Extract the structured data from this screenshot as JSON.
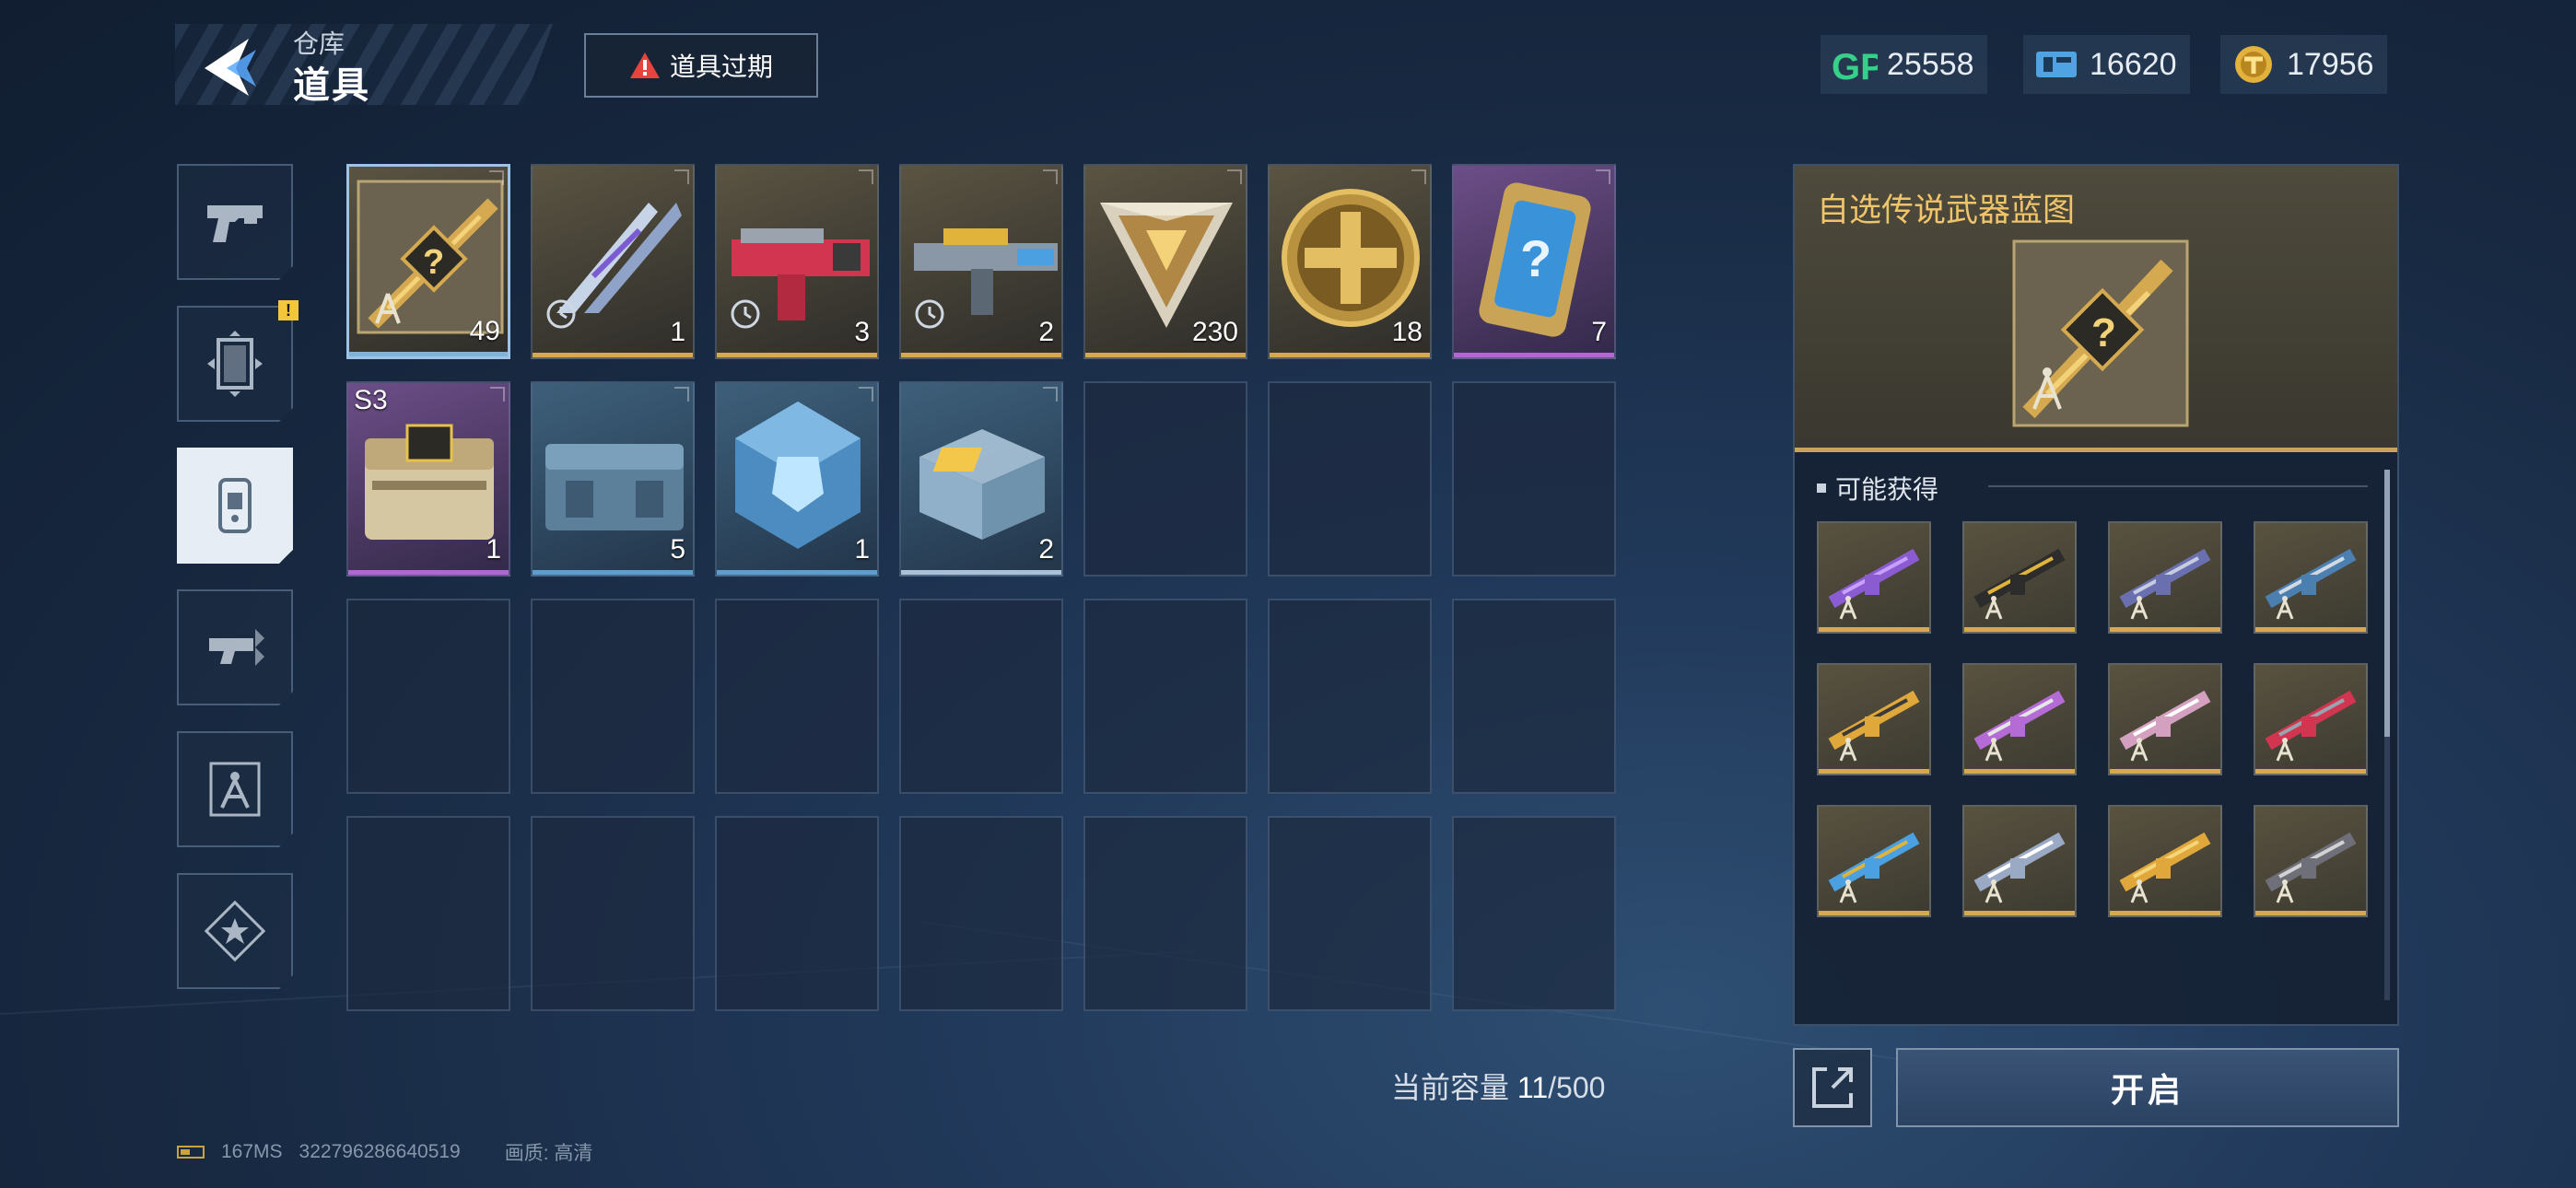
{
  "header": {
    "subtitle": "仓库",
    "title": "道具",
    "expire_button": "道具过期"
  },
  "currencies": [
    {
      "icon": "gp-coin-icon",
      "value": "25558"
    },
    {
      "icon": "ticket-icon",
      "value": "16620"
    },
    {
      "icon": "gold-medal-icon",
      "value": "17956"
    }
  ],
  "sidebar": {
    "items": [
      {
        "name": "weapon",
        "icon": "pistol-icon"
      },
      {
        "name": "skin",
        "icon": "scroll-icon",
        "badge": "!"
      },
      {
        "name": "items",
        "icon": "item-tag-icon",
        "active": true
      },
      {
        "name": "attachments",
        "icon": "gun-part-icon"
      },
      {
        "name": "blueprints",
        "icon": "compass-icon"
      },
      {
        "name": "special",
        "icon": "star-icon"
      }
    ]
  },
  "inventory": {
    "items": [
      {
        "name": "legendary-blueprint-selector",
        "count": "49",
        "rarity_color": "#7fb3d9",
        "selected": true
      },
      {
        "name": "dual-blade-skin",
        "count": "1",
        "rarity_color": "#d5a94f",
        "timed": true
      },
      {
        "name": "red-shotgun-skin",
        "count": "3",
        "rarity_color": "#d5a94f",
        "timed": true
      },
      {
        "name": "rifle-skin",
        "count": "2",
        "rarity_color": "#d5a94f",
        "timed": true
      },
      {
        "name": "triangle-token",
        "count": "230",
        "rarity_color": "#d5a94f"
      },
      {
        "name": "gold-cross-coin",
        "count": "18",
        "rarity_color": "#d5a94f"
      },
      {
        "name": "mystery-card",
        "count": "7",
        "rarity_color": "#b266d6"
      },
      {
        "name": "s3-supply-crate",
        "tag": "S3",
        "count": "1",
        "rarity_color": "#b266d6"
      },
      {
        "name": "blue-supply-crate",
        "count": "5",
        "rarity_color": "#5e9ecf"
      },
      {
        "name": "blue-cube-crate",
        "count": "1",
        "rarity_color": "#5e9ecf"
      },
      {
        "name": "glass-crate",
        "count": "2",
        "rarity_color": "#a9c0d6"
      }
    ]
  },
  "capacity": {
    "label": "当前容量 ",
    "current": "11",
    "max": "/500"
  },
  "status_bar": {
    "ping": "167MS",
    "uid": "322796286640519",
    "quality": "画质: 高清"
  },
  "detail": {
    "title": "自选传说武器蓝图",
    "section": "可能获得",
    "open_button": "开启"
  },
  "colors": {
    "gold": "#d5a94f",
    "purple": "#b266d6",
    "blue": "#5e9ecf",
    "title_gold": "#f0c46a"
  }
}
